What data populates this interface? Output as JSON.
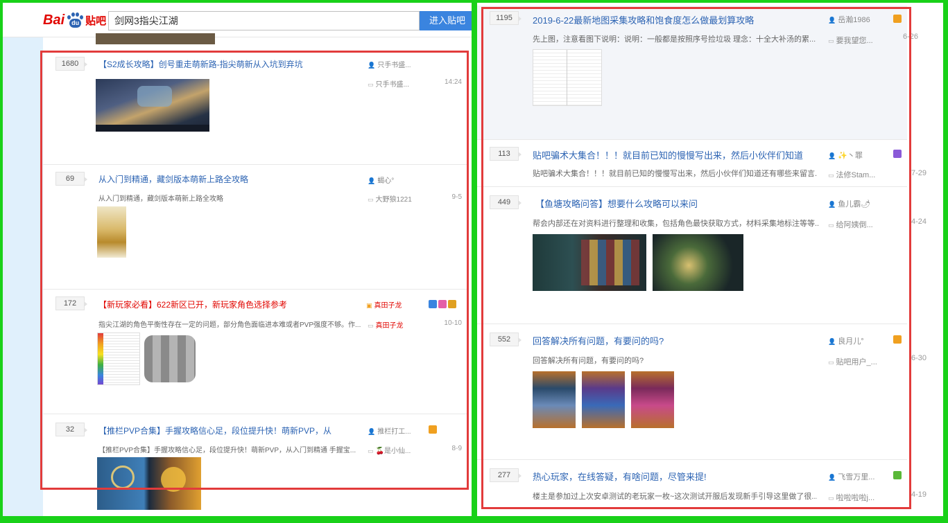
{
  "left": {
    "logo": {
      "text_bai": "Bai",
      "text_du": "du",
      "text_tieba": "贴吧"
    },
    "search": {
      "value": "剑网3指尖江湖",
      "button": "进入贴吧"
    },
    "threads": [
      {
        "reply_count": "1680",
        "title": "【S2成长攻略】创号重走萌新路-指尖萌新从入坑到弃坑",
        "author": "只手书盛...",
        "last_reply_user": "只手书盛...",
        "time": "14:24"
      },
      {
        "reply_count": "69",
        "title": "从入门到精通，藏剑版本萌新上路全攻略",
        "desc": "从入门到精通，藏剑版本萌新上路全攻略",
        "author": "蝎心°",
        "last_reply_user": "大野狼1221",
        "time": "9-5"
      },
      {
        "reply_count": "172",
        "title": "【新玩家必看】622新区已开，新玩家角色选择参考",
        "desc": "指尖江湖的角色平衡性存在一定的问题，部分角色面临进本难或者PVP强度不够。作...",
        "author": "真田子龙",
        "last_reply_user": "真田子龙",
        "time": "10-10"
      },
      {
        "reply_count": "32",
        "title": "【推栏PVP合集】手握攻略信心足，段位提升快！萌新PVP，从",
        "desc": "【推栏PVP合集】手握攻略信心足，段位提升快！萌新PVP，从入门到精通 手握宝...",
        "author": "推栏打工...",
        "last_reply_user": "🍒是小仙...",
        "time": "8-9"
      }
    ]
  },
  "right": {
    "threads": [
      {
        "reply_count": "1195",
        "title": "2019-6-22最新地图采集攻略和饱食度怎么做最划算攻略",
        "desc": "先上图，注意看图下说明：说明：一般都是按照序号捡垃圾 理念：十全大补汤的累...",
        "author": "岳瀚1986",
        "last_reply_user": "要我望您...",
        "time": "6-26"
      },
      {
        "reply_count": "113",
        "title": "贴吧骗术大集合！！！就目前已知的慢慢写出来，然后小伙伴们知道",
        "desc": "贴吧骗术大集合！！！就目前已知的慢慢写出来，然后小伙伴们知道还有哪些来留言...",
        "author": "✨丶罪",
        "last_reply_user": "法修Stam...",
        "time": "7-29"
      },
      {
        "reply_count": "449",
        "title": "【鱼塘攻略问答】想要什么攻略可以来问",
        "desc": "帮会内部还在对资料进行整理和收集，包括角色最快获取方式，材料采集地标注等等...",
        "author": "鱼儿霸🌶",
        "last_reply_user": "给阿姨倒...",
        "time": "4-24"
      },
      {
        "reply_count": "552",
        "title": "回答解决所有问题，有要问的吗?",
        "desc": "回答解决所有问题，有要问的吗?",
        "author": "良月儿°",
        "last_reply_user": "贴吧用户_...",
        "time": "6-30"
      },
      {
        "reply_count": "277",
        "title": "热心玩家，在线答疑，有啥问题，尽管来提!",
        "desc": "楼主是参加过上次安卓测试的老玩家一枚~这次测试开服后发现新手引导这里做了很...",
        "author": "飞雪万里...",
        "last_reply_user": "啦啦啦啦j...",
        "time": "4-19"
      }
    ]
  },
  "colors": {
    "title_blue": "#2d64b3",
    "red": "#e10601",
    "highlight_border": "#e23b3b",
    "frame_green": "#19d119",
    "button_blue": "#3a84df"
  },
  "icons": {
    "author": "user-icon",
    "reply": "comment-icon"
  }
}
